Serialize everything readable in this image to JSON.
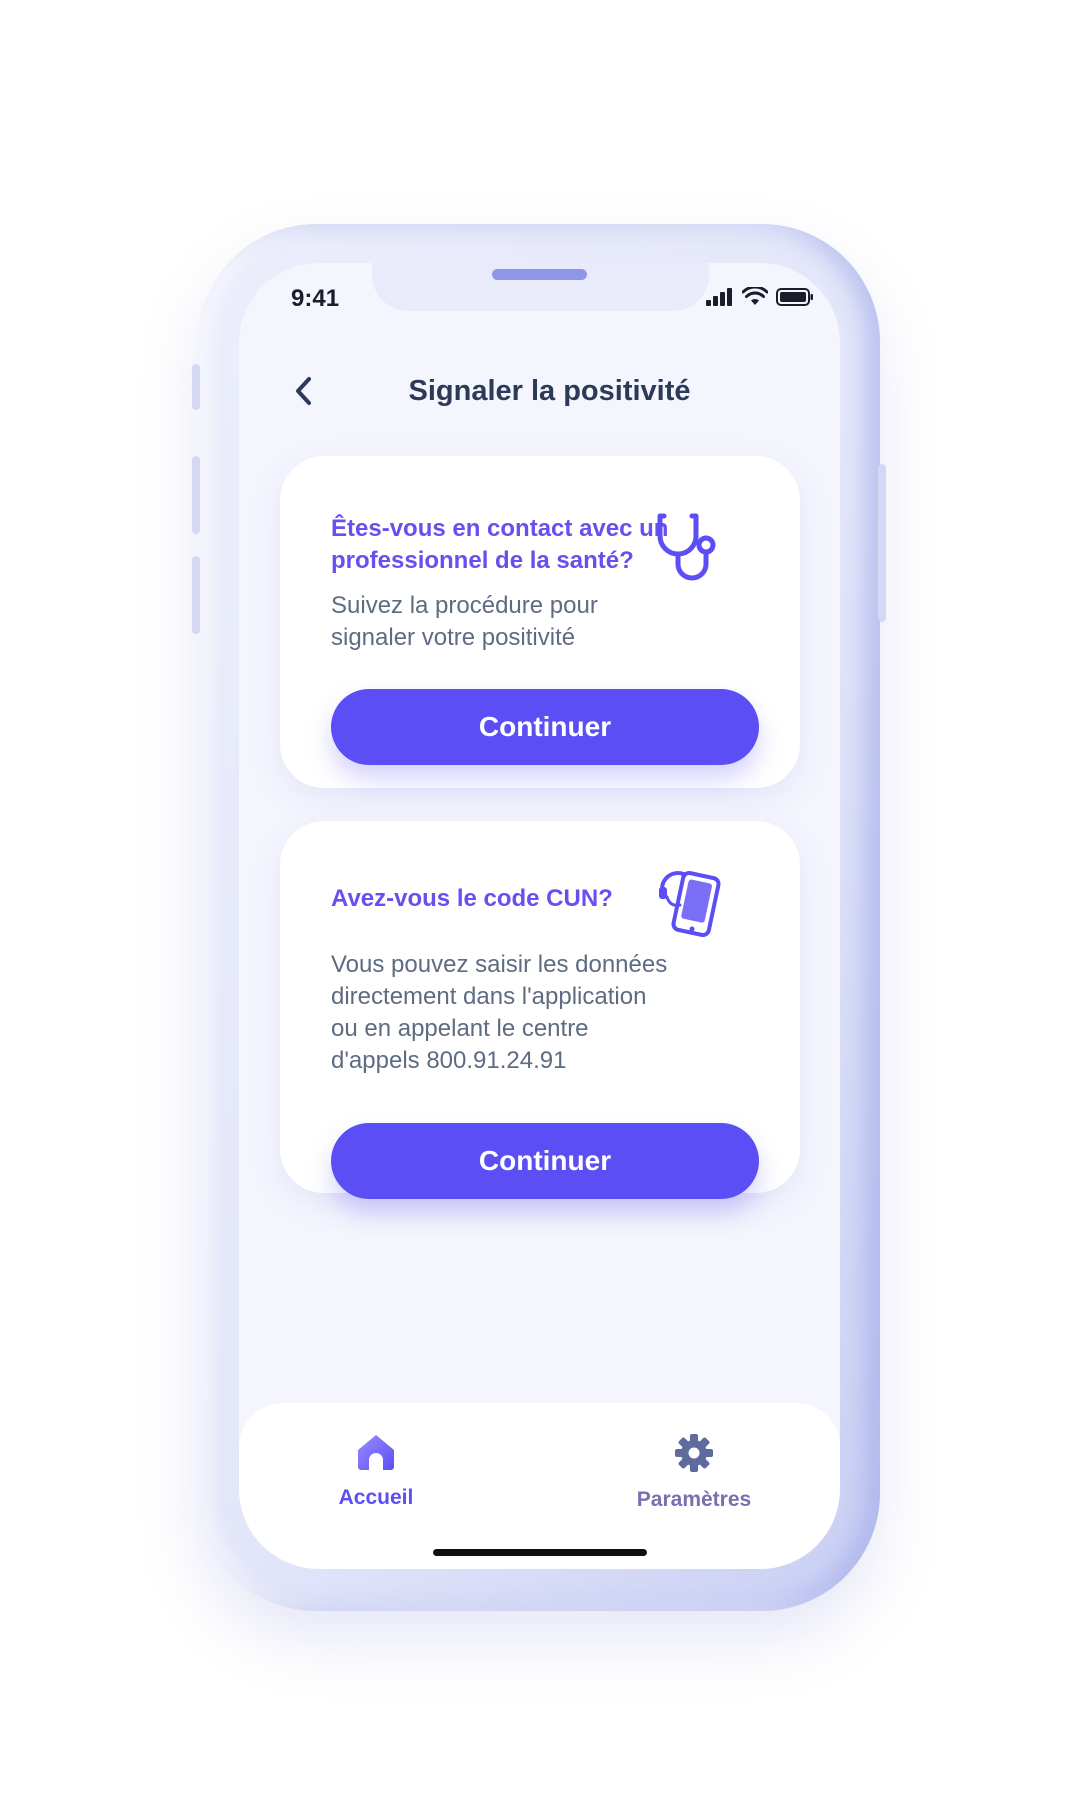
{
  "status_bar": {
    "time": "9:41"
  },
  "header": {
    "title": "Signaler la positivité"
  },
  "cards": [
    {
      "title_line1": "Êtes-vous en contact avec un",
      "title_line2": "professionnel de la santé?",
      "text_line1": "Suivez la procédure pour",
      "text_line2": "signaler votre positivité",
      "button_label": "Continuer",
      "icon": "stethoscope-icon"
    },
    {
      "title_line1": "Avez-vous le code CUN?",
      "text_line1": "Vous pouvez saisir les données",
      "text_line2": "directement dans l'application",
      "text_line3": "ou en appelant le centre",
      "text_line4": "d'appels 800.91.24.91",
      "button_label": "Continuer",
      "icon": "phone-support-icon"
    }
  ],
  "tabbar": {
    "items": [
      {
        "label": "Accueil",
        "icon": "home-icon",
        "active": true
      },
      {
        "label": "Paramètres",
        "icon": "gear-icon",
        "active": false
      }
    ]
  },
  "colors": {
    "accent": "#5b4ef5",
    "title_purple": "#6b4df1",
    "header_text": "#2c3a57",
    "body_text": "#5e6b82",
    "inactive_tab": "#7a6fb0"
  }
}
